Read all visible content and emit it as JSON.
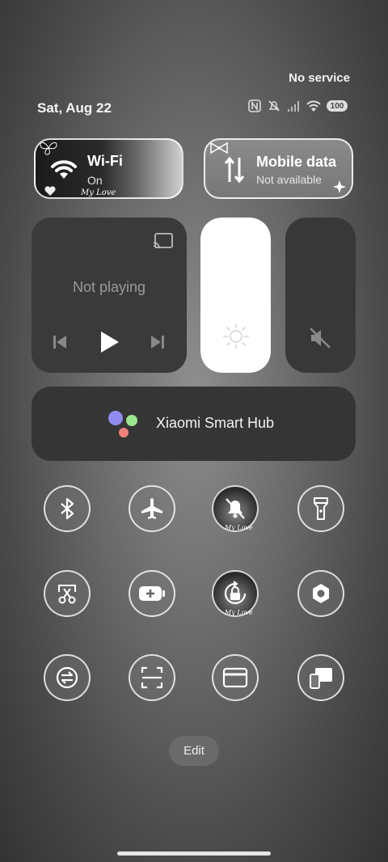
{
  "status": {
    "carrier": "No service",
    "date": "Sat, Aug 22",
    "battery": "100"
  },
  "wifi": {
    "title": "Wi-Fi",
    "state": "On",
    "decoration": "My Love"
  },
  "mobile": {
    "title": "Mobile data",
    "state": "Not available"
  },
  "media": {
    "label": "Not playing"
  },
  "brightness": {
    "level_fraction": 1.0
  },
  "hub": {
    "label": "Xiaomi Smart Hub"
  },
  "toggles": {
    "row1": [
      "bluetooth-icon",
      "airplane-icon",
      "silent-icon",
      "flashlight-icon"
    ],
    "row2": [
      "screenshot-icon",
      "battery-saver-icon",
      "rotation-lock-icon",
      "settings-icon"
    ],
    "row3": [
      "sync-icon",
      "scanner-icon",
      "card-icon",
      "cast-devices-icon"
    ],
    "decoration": "My Love"
  },
  "edit": {
    "label": "Edit"
  },
  "colors": {
    "tile_dark": "#3a3a3a",
    "accent_white": "#ffffff",
    "hub_blue": "#8f8cf2",
    "hub_green": "#9be58f",
    "hub_red": "#f0807a"
  }
}
